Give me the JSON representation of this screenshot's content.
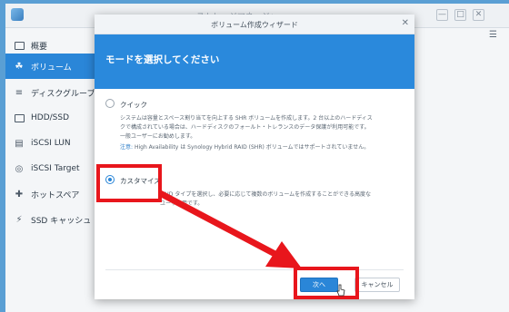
{
  "outer_window": {
    "title": "ストレージマネージャー",
    "minimize_glyph": "—",
    "maximize_glyph": "□",
    "close_glyph": "✕"
  },
  "sidebar": {
    "items": [
      {
        "label": "概要",
        "icon": "overview-icon"
      },
      {
        "label": "ボリューム",
        "icon": "volume-icon",
        "active": true
      },
      {
        "label": "ディスクグループ",
        "icon": "disk-group-icon"
      },
      {
        "label": "HDD/SSD",
        "icon": "hdd-icon"
      },
      {
        "label": "iSCSI LUN",
        "icon": "iscsi-lun-icon"
      },
      {
        "label": "iSCSI Target",
        "icon": "iscsi-target-icon"
      },
      {
        "label": "ホットスペア",
        "icon": "hot-spare-icon"
      },
      {
        "label": "SSD キャッシュ",
        "icon": "ssd-cache-icon"
      }
    ]
  },
  "wizard": {
    "title": "ボリューム作成ウィザード",
    "close_glyph": "✕",
    "heading": "モードを選択してください",
    "options": {
      "quick": {
        "label": "クイック",
        "desc_line1": "システムは容量とスペース割り当てを向上する SHR ボリュームを作成します。2 台以上のハードディス",
        "desc_line2": "クで構成されている場合は、ハードディスクのフォールト・トレランスのデータ保護が利用可能です。",
        "desc_line3": "一般ユーザーにお勧めします。",
        "note_label": "注意:",
        "note_text": "High Availability は Synology Hybrid RAID (SHR) ボリュームではサポートされていません。"
      },
      "custom": {
        "label": "カスタマイズ",
        "desc_line1": "RAID タイプを選択し、必要に応じて複数のボリュームを作成することができる高度な",
        "desc_line2": "ユーザー用です。",
        "selected": true
      }
    },
    "buttons": {
      "next": "次へ",
      "cancel": "キャンセル"
    }
  },
  "annotations": {
    "color": "#e8161c"
  },
  "colors": {
    "accent": "#2a86d8",
    "header": "#2a89dc",
    "desktop": "#5a9fd4"
  }
}
